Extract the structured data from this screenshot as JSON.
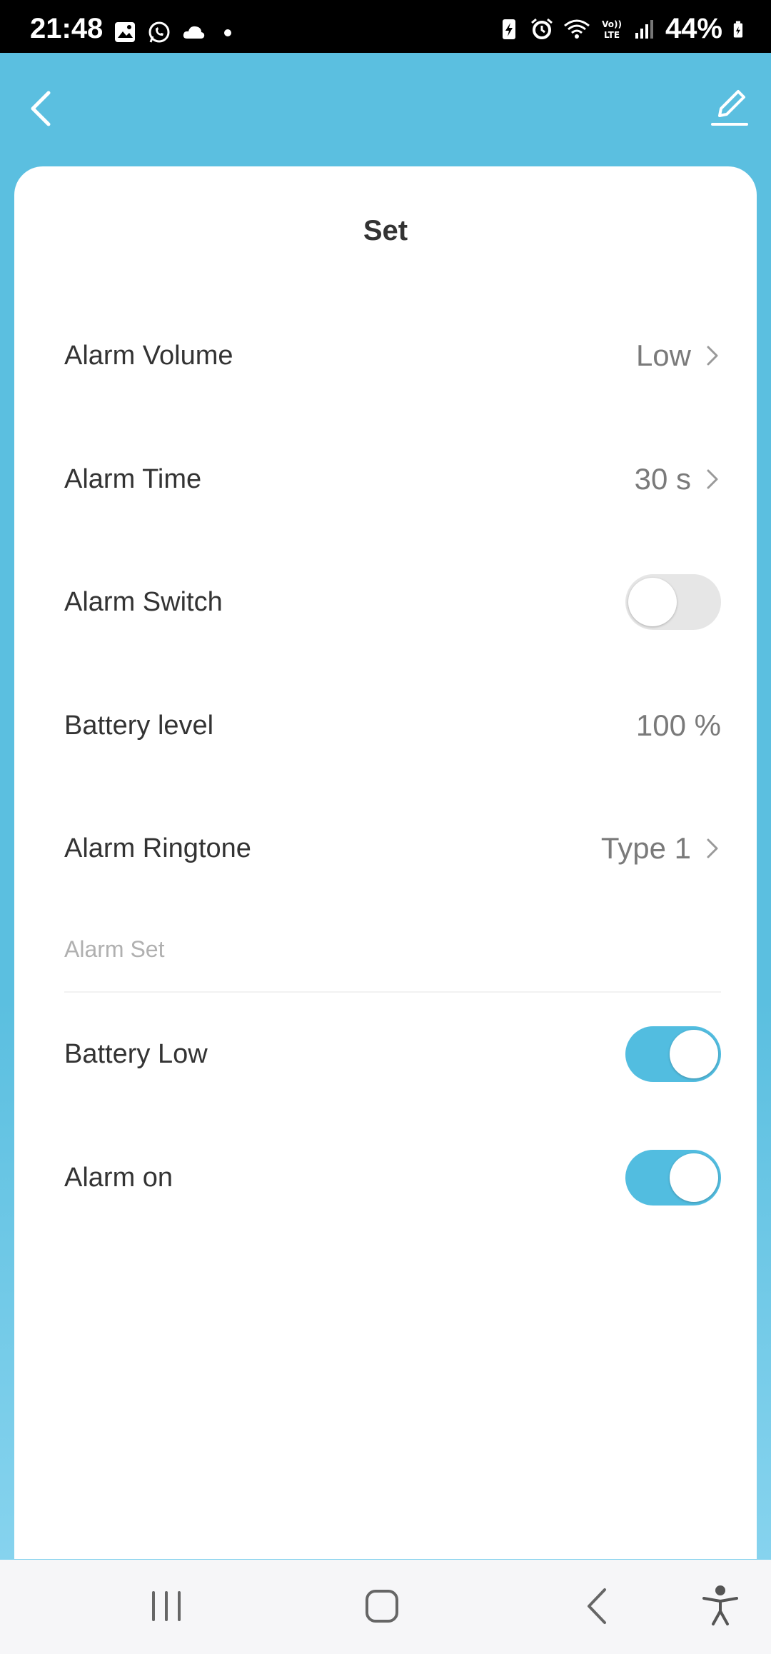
{
  "status_bar": {
    "time": "21:48",
    "battery_percent": "44%",
    "left_icons": [
      "gallery-icon",
      "whatsapp-icon",
      "cloud-icon",
      "dot-icon"
    ],
    "right_icons": [
      "battery-saver-icon",
      "alarm-icon",
      "wifi-icon",
      "volte-icon",
      "signal-icon",
      "battery-icon"
    ]
  },
  "header": {
    "back_icon": "chevron-left-icon",
    "edit_icon": "pencil-icon",
    "accent_color": "#5bbfe0"
  },
  "card": {
    "title": "Set",
    "rows": [
      {
        "label": "Alarm Volume",
        "value": "Low",
        "has_chevron": true
      },
      {
        "label": "Alarm Time",
        "value": "30 s",
        "has_chevron": true
      },
      {
        "label": "Alarm Switch",
        "toggle": "off"
      },
      {
        "label": "Battery level",
        "value": "100 %"
      },
      {
        "label": "Alarm Ringtone",
        "value": "Type 1",
        "has_chevron": true
      }
    ],
    "section_label": "Alarm Set",
    "alarm_set_rows": [
      {
        "label": "Battery Low",
        "toggle": "on"
      },
      {
        "label": "Alarm on",
        "toggle": "on"
      }
    ]
  },
  "nav_bar": {
    "icons": [
      "recent-apps-icon",
      "home-icon",
      "back-icon",
      "accessibility-icon"
    ]
  }
}
